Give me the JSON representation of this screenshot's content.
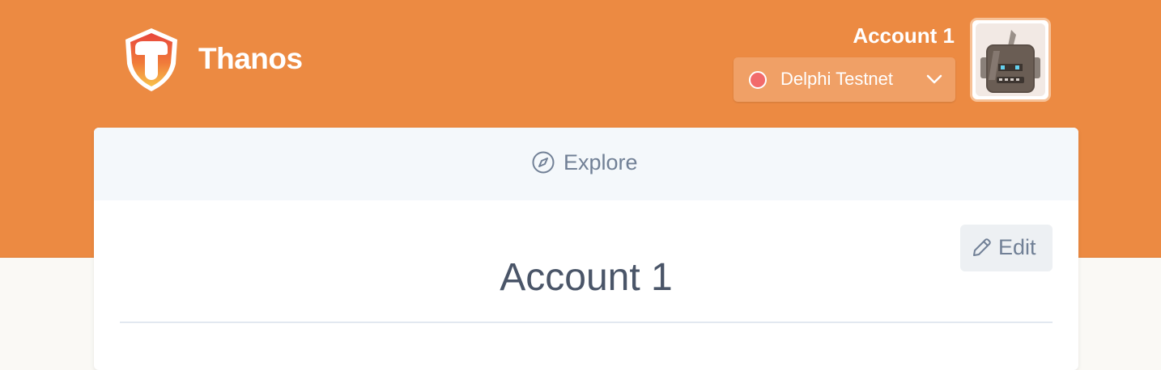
{
  "header": {
    "brand_name": "Thanos",
    "account_name": "Account 1",
    "network": {
      "label": "Delphi Testnet",
      "status_color": "#f26b6b"
    },
    "background_color": "#ec8a42"
  },
  "tabs": [
    {
      "label": "Explore",
      "icon": "compass-icon"
    }
  ],
  "main": {
    "title": "Account 1",
    "edit_label": "Edit",
    "edit_icon": "pencil-icon"
  }
}
